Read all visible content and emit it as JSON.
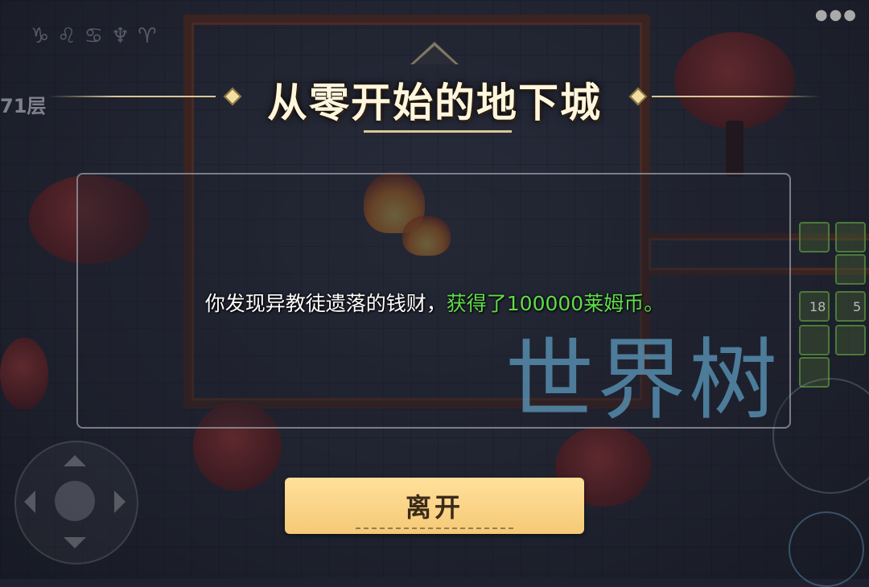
{
  "hud": {
    "zodiac_glyphs": "♑♌♋♆♈",
    "floor_label": "71层",
    "menu_dots": "●●●",
    "skill_counts": [
      "18",
      "5"
    ]
  },
  "event": {
    "title": "从零开始的地下城",
    "message_prefix": "你发现异教徒遗落的钱财，",
    "message_highlight": "获得了100000莱姆币。",
    "leave_button": "离开"
  },
  "watermark": "世界树",
  "colors": {
    "title_text": "#fff6dd",
    "highlight_green": "#5fdc4a",
    "button_bg": "#f5c977",
    "watermark": "#5a96b9"
  },
  "icons": [
    "joystick-icon",
    "skill-slot-icon",
    "diamond-ornament-icon"
  ]
}
